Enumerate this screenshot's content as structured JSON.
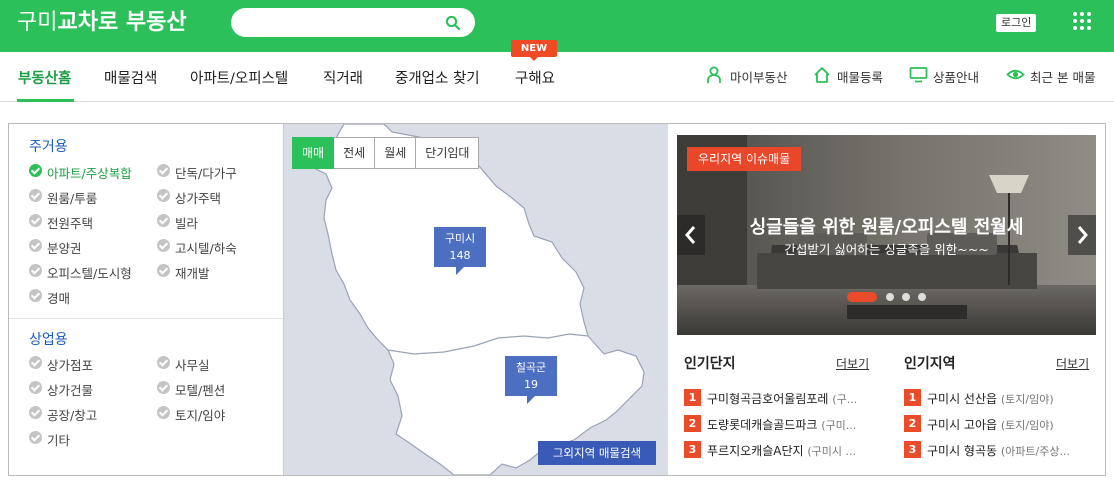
{
  "header": {
    "logo_thin": "구미",
    "logo_bold": "교차로 부동산",
    "search_placeholder": "",
    "login": "로그인"
  },
  "nav": {
    "items": [
      {
        "label": "부동산홈"
      },
      {
        "label": "매물검색"
      },
      {
        "label": "아파트/오피스텔"
      },
      {
        "label": "직거래"
      },
      {
        "label": "중개업소 찾기"
      },
      {
        "label": "구해요"
      }
    ],
    "new_badge": "NEW",
    "right": [
      {
        "label": "마이부동산",
        "icon": "person-icon"
      },
      {
        "label": "매물등록",
        "icon": "house-icon"
      },
      {
        "label": "상품안내",
        "icon": "monitor-icon"
      },
      {
        "label": "최근 본 매물",
        "icon": "eye-icon"
      }
    ]
  },
  "residential": {
    "title": "주거용",
    "items": [
      {
        "label": "아파트/주상복합",
        "checked": true
      },
      {
        "label": "단독/다가구",
        "checked": false
      },
      {
        "label": "원룸/투룸",
        "checked": false
      },
      {
        "label": "상가주택",
        "checked": false
      },
      {
        "label": "전원주택",
        "checked": false
      },
      {
        "label": "빌라",
        "checked": false
      },
      {
        "label": "분양권",
        "checked": false
      },
      {
        "label": "고시텔/하숙",
        "checked": false
      },
      {
        "label": "오피스텔/도시형",
        "checked": false
      },
      {
        "label": "재개발",
        "checked": false
      },
      {
        "label": "경매",
        "checked": false
      }
    ]
  },
  "commercial": {
    "title": "상업용",
    "items": [
      {
        "label": "상가점포",
        "checked": false
      },
      {
        "label": "사무실",
        "checked": false
      },
      {
        "label": "상가건물",
        "checked": false
      },
      {
        "label": "모텔/펜션",
        "checked": false
      },
      {
        "label": "공장/창고",
        "checked": false
      },
      {
        "label": "토지/임야",
        "checked": false
      },
      {
        "label": "기타",
        "checked": false
      }
    ]
  },
  "map": {
    "tabs": [
      {
        "label": "매매",
        "active": true
      },
      {
        "label": "전세",
        "active": false
      },
      {
        "label": "월세",
        "active": false
      },
      {
        "label": "단기임대",
        "active": false
      }
    ],
    "markers": [
      {
        "name": "구미시",
        "count": "148"
      },
      {
        "name": "칠곡군",
        "count": "19"
      }
    ],
    "other_button": "그외지역 매물검색"
  },
  "banner": {
    "tag": "우리지역 이슈매물",
    "title": "싱글들을 위한 원룸/오피스텔 전월세",
    "subtitle": "간섭받기 싫어하는 싱글족을 위한~~~",
    "active_slide": 1,
    "slide_count": 4
  },
  "popular_complex": {
    "title": "인기단지",
    "more": "더보기",
    "rows": [
      {
        "rank": "1",
        "name": "구미형곡금호어울림포레",
        "sub": "(구..."
      },
      {
        "rank": "2",
        "name": "도량롯데캐슬골드파크",
        "sub": "(구미..."
      },
      {
        "rank": "3",
        "name": "푸르지오캐슬A단지",
        "sub": "(구미시 ..."
      }
    ]
  },
  "popular_region": {
    "title": "인기지역",
    "more": "더보기",
    "rows": [
      {
        "rank": "1",
        "name": "구미시 선산읍",
        "sub": "(토지/임야)"
      },
      {
        "rank": "2",
        "name": "구미시 고아읍",
        "sub": "(토지/임야)"
      },
      {
        "rank": "3",
        "name": "구미시 형곡동",
        "sub": "(아파트/주상..."
      }
    ]
  },
  "colors": {
    "brand_green": "#2cc05a",
    "accent_red": "#ea4c2a",
    "marker_blue": "#4d6fc1",
    "section_blue": "#1d5bbf"
  }
}
